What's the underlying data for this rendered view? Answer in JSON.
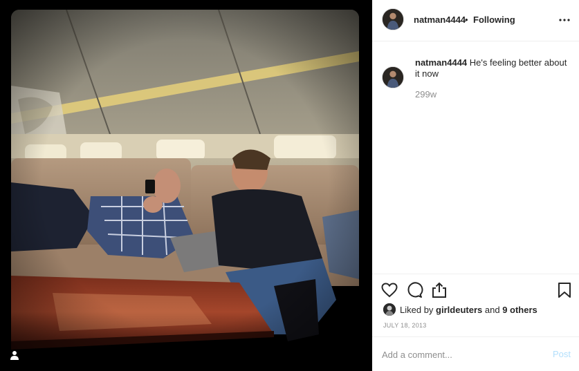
{
  "post": {
    "username": "natman4444",
    "separator": "•",
    "follow_status": "Following",
    "caption_user": "natman4444",
    "caption_text": "He's feeling better about it now",
    "caption_age": "299w",
    "liked_by_prefix": "Liked by",
    "liked_by_user": "girldeuters",
    "liked_by_and": "and",
    "liked_by_others": "9 others",
    "date": "JULY 18, 2013"
  },
  "comment_box": {
    "placeholder": "Add a comment...",
    "post_label": "Post"
  },
  "icons": {
    "tag": "user-tag-icon",
    "more": "more-options-icon",
    "like": "heart-icon",
    "comment": "comment-bubble-icon",
    "share": "share-icon",
    "save": "bookmark-icon"
  },
  "colors": {
    "text": "#262626",
    "secondary": "#8e8e8e",
    "border": "#efefef",
    "post_button_disabled": "#b2dffc",
    "media_background": "#000000"
  }
}
